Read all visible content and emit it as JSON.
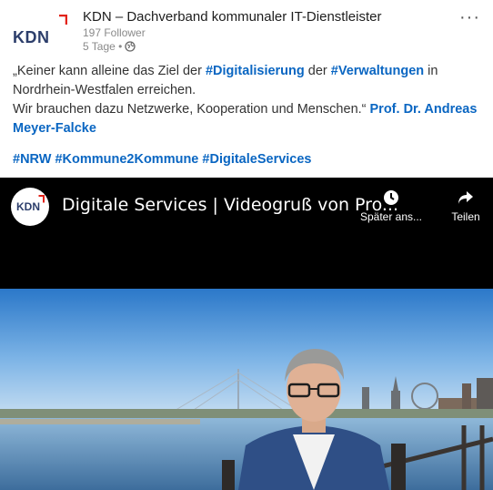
{
  "author": {
    "logo_text": "KDN",
    "name": "KDN – Dachverband kommunaler IT-Dienstleister",
    "followers": "197 Follower",
    "time": "5 Tage •"
  },
  "post": {
    "line1_a": "„Keiner kann alleine das Ziel der ",
    "hashtag_digitalisierung": "#Digitalisierung",
    "line1_b": " der ",
    "hashtag_verwaltungen": "#Verwaltungen",
    "line1_c": " in Nordrhein-Westfalen erreichen.",
    "line2_a": "Wir brauchen dazu Netzwerke, Kooperation und Menschen.“ ",
    "mention": "Prof. Dr. Andreas Meyer-Falcke",
    "hashtags": "#NRW #Kommune2Kommune #DigitaleServices"
  },
  "video": {
    "channel_logo_text": "KDN",
    "title": "Digitale Services | Videogruß von Pro...",
    "watch_later_label": "Später ans...",
    "share_label": "Teilen"
  },
  "icons": {
    "globe": "globe-icon",
    "more": "more-options-icon",
    "clock": "clock-icon",
    "share": "share-arrow-icon"
  },
  "colors": {
    "link": "#0a66c2",
    "logo_red": "#e2231a",
    "logo_blue": "#2c3e6b"
  }
}
